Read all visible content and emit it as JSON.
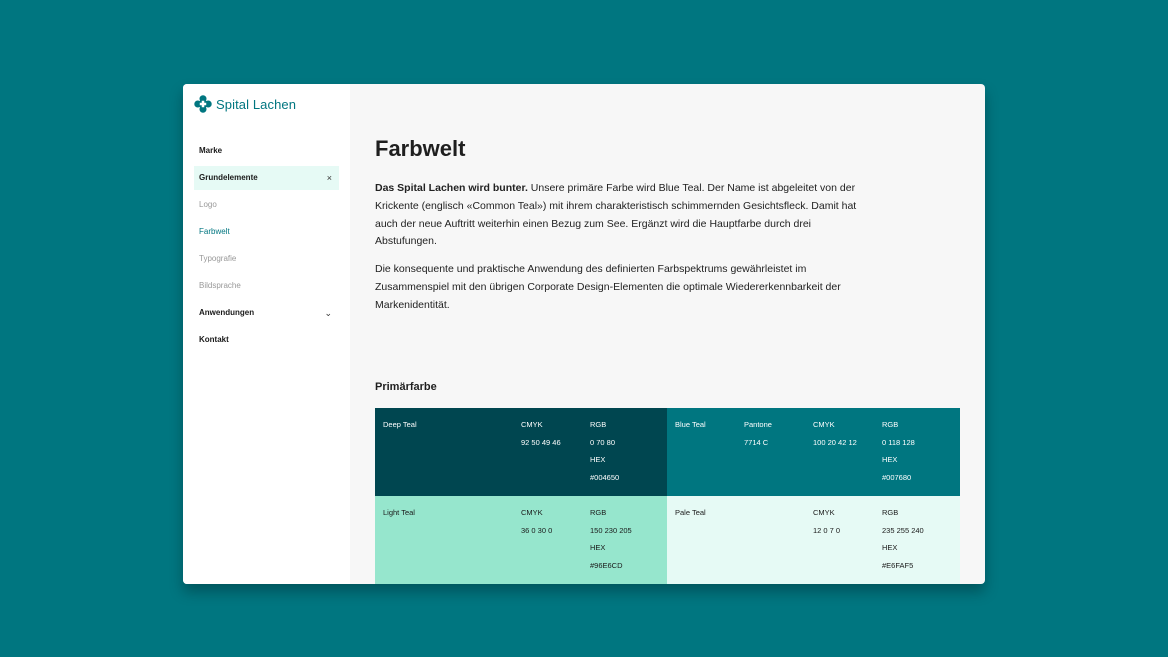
{
  "brand": {
    "name": "Spital Lachen",
    "accent": "#007680"
  },
  "sidebar": {
    "items": [
      {
        "label": "Marke"
      },
      {
        "label": "Grundelemente",
        "trail": "×"
      },
      {
        "label": "Logo"
      },
      {
        "label": "Farbwelt"
      },
      {
        "label": "Typografie"
      },
      {
        "label": "Bildsprache"
      },
      {
        "label": "Anwendungen",
        "trail": "⌄"
      },
      {
        "label": "Kontakt"
      }
    ]
  },
  "main": {
    "title": "Farbwelt",
    "intro_bold": "Das Spital Lachen wird bunter.",
    "intro_rest": " Unsere primäre Farbe wird Blue Teal. Der Name ist abgeleitet von der Krickente (englisch «Common Teal») mit ihrem charakteristisch schimmernden Gesichtsfleck. Damit hat auch der neue Auftritt weiterhin einen Bezug zum See. Ergänzt wird die Hauptfarbe durch drei Abstufungen.",
    "paragraph2": "Die konsequente und praktische Anwendung des definierten Farbspektrums gewährleistet im Zusammenspiel mit den übrigen Corporate Design-Elementen die optimale Wiedererkennbarkeit der Markenidentität.",
    "section_title": "Primärfarbe"
  },
  "swatches": [
    {
      "name": "Deep Teal",
      "bg": "#004650",
      "fg": "#ffffff",
      "pantone_label": "",
      "pantone": "",
      "cmyk_label": "CMYK",
      "cmyk": "92 50 49 46",
      "rgb_label": "RGB",
      "rgb": "0 70 80",
      "hex_label": "HEX",
      "hex": "#004650"
    },
    {
      "name": "Blue Teal",
      "bg": "#007680",
      "fg": "#ffffff",
      "pantone_label": "Pantone",
      "pantone": "7714 C",
      "cmyk_label": "CMYK",
      "cmyk": "100 20 42 12",
      "rgb_label": "RGB",
      "rgb": "0 118 128",
      "hex_label": "HEX",
      "hex": "#007680"
    },
    {
      "name": "Light Teal",
      "bg": "#96e6cd",
      "fg": "#1a1a1a",
      "pantone_label": "",
      "pantone": "",
      "cmyk_label": "CMYK",
      "cmyk": "36 0 30 0",
      "rgb_label": "RGB",
      "rgb": "150 230 205",
      "hex_label": "HEX",
      "hex": "#96E6CD"
    },
    {
      "name": "Pale Teal",
      "bg": "#e6faf5",
      "fg": "#1a1a1a",
      "pantone_label": "",
      "pantone": "",
      "cmyk_label": "CMYK",
      "cmyk": "12 0 7 0",
      "rgb_label": "RGB",
      "rgb": "235 255 240",
      "hex_label": "HEX",
      "hex": "#E6FAF5"
    }
  ],
  "icons": {
    "logo": "flower-cross-icon"
  }
}
